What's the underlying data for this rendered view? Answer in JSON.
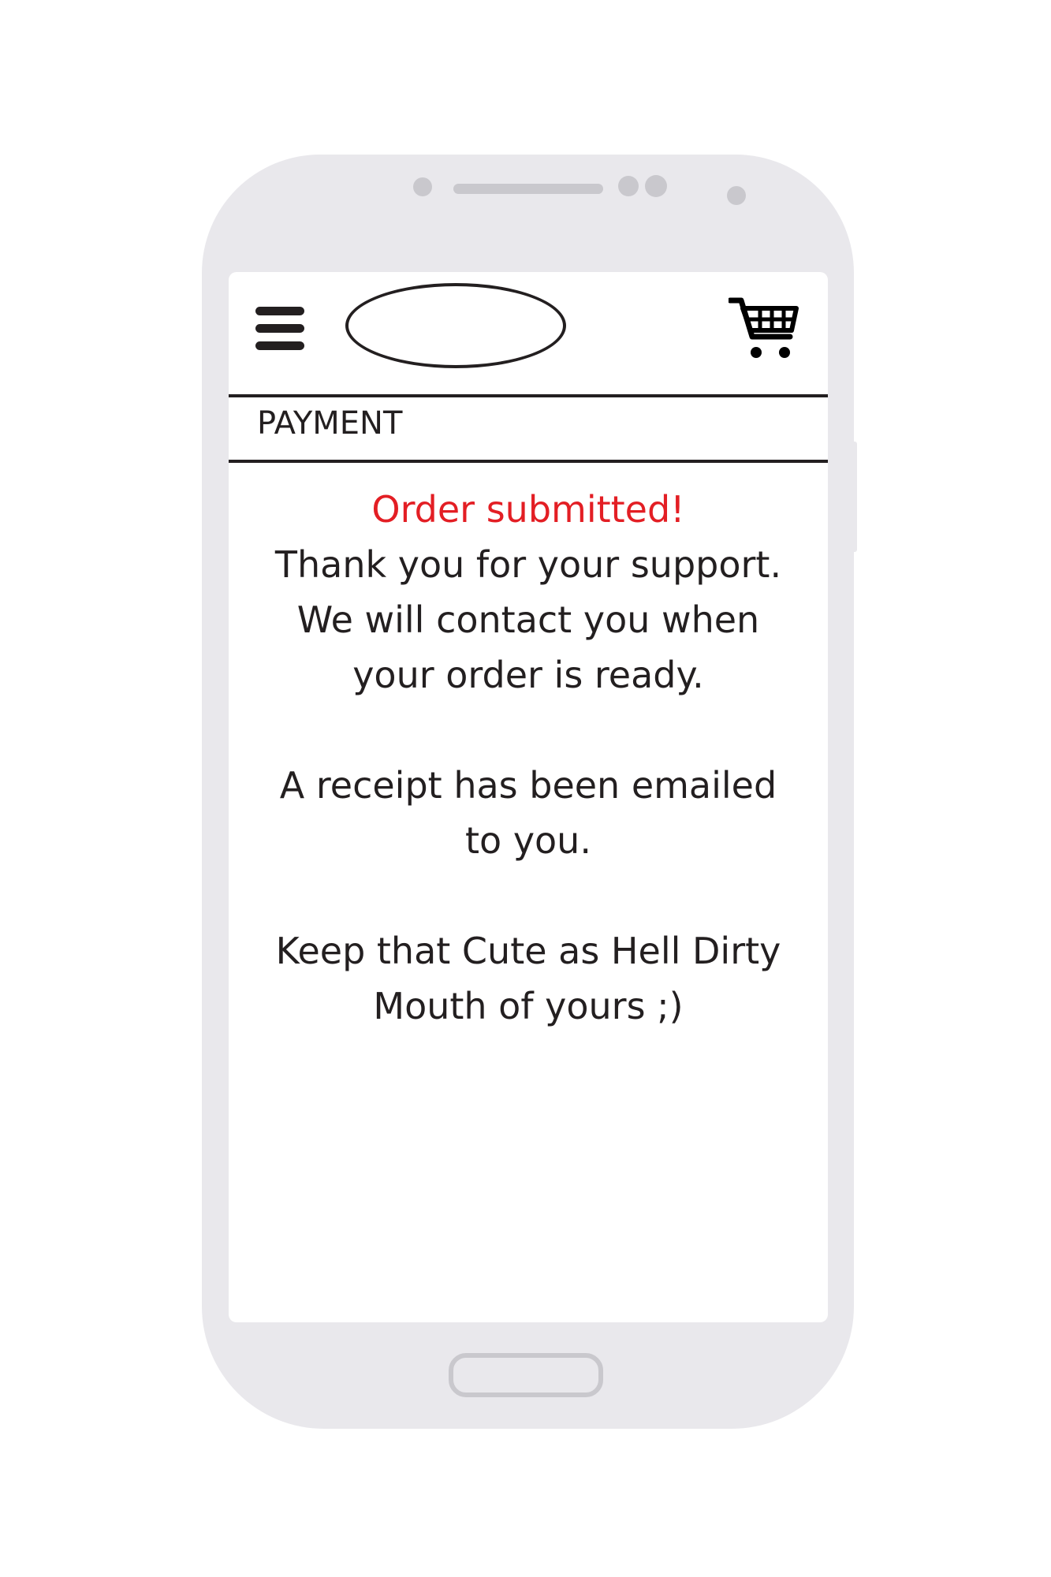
{
  "header": {
    "menu_icon": "hamburger-menu-icon",
    "logo": "logo-placeholder",
    "cart_icon": "shopping-cart-icon"
  },
  "section": {
    "title": "PAYMENT"
  },
  "confirmation": {
    "status": "Order submitted!",
    "line1": "Thank you for your support.",
    "line2": "We will contact you when\nyour order is ready.",
    "receipt": "A receipt has been emailed\nto you.",
    "signoff": "Keep that Cute as Hell Dirty\nMouth of yours ;)"
  },
  "colors": {
    "status": "#e31e24",
    "text": "#231f20",
    "device_body": "#e9e8ec",
    "device_detail": "#c9c8cd"
  }
}
